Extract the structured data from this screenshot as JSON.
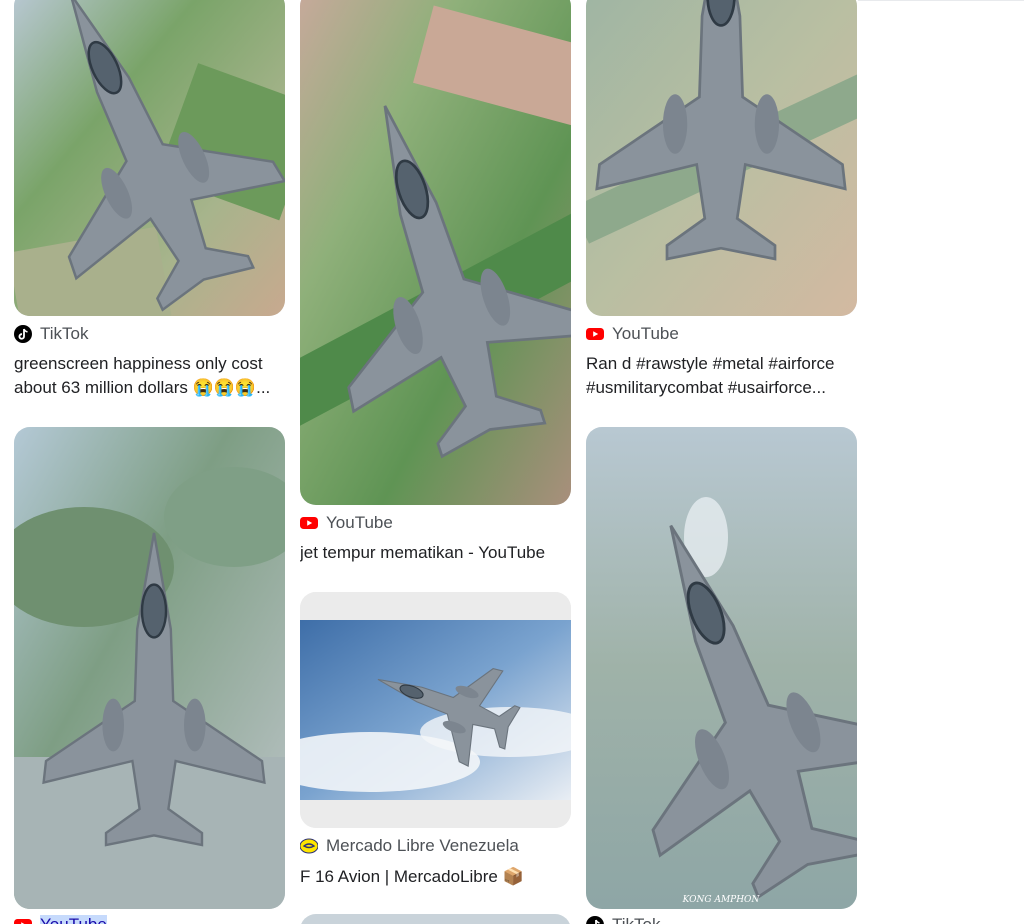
{
  "results": [
    {
      "source": "TikTok",
      "title": "greenscreen happiness only cost about 63 million dollars 😭😭😭..."
    },
    {
      "source": "YouTube",
      "title": "jet tempur mematikan - YouTube"
    },
    {
      "source": "YouTube",
      "title": "Ran d #rawstyle #metal #airforce #usmilitarycombat #usairforce..."
    },
    {
      "source": "YouTube",
      "title": ""
    },
    {
      "source": "Mercado Libre Venezuela",
      "title": "F 16 Avion | MercadoLibre 📦"
    },
    {
      "source": "TikTok",
      "title": ""
    }
  ],
  "watermark": "KONG AMPHON",
  "colors": {
    "tiktok": "#000000",
    "youtube": "#ff0000",
    "mercadolibre": "#ffe600",
    "source_text": "#4d5156",
    "title_text": "#202124",
    "field_green": "#6f9d5a",
    "jet_gray": "#8a939c",
    "sky_blue": "#4f7fb5"
  },
  "icons": [
    "tiktok-icon",
    "youtube-icon",
    "mercadolibre-icon"
  ]
}
